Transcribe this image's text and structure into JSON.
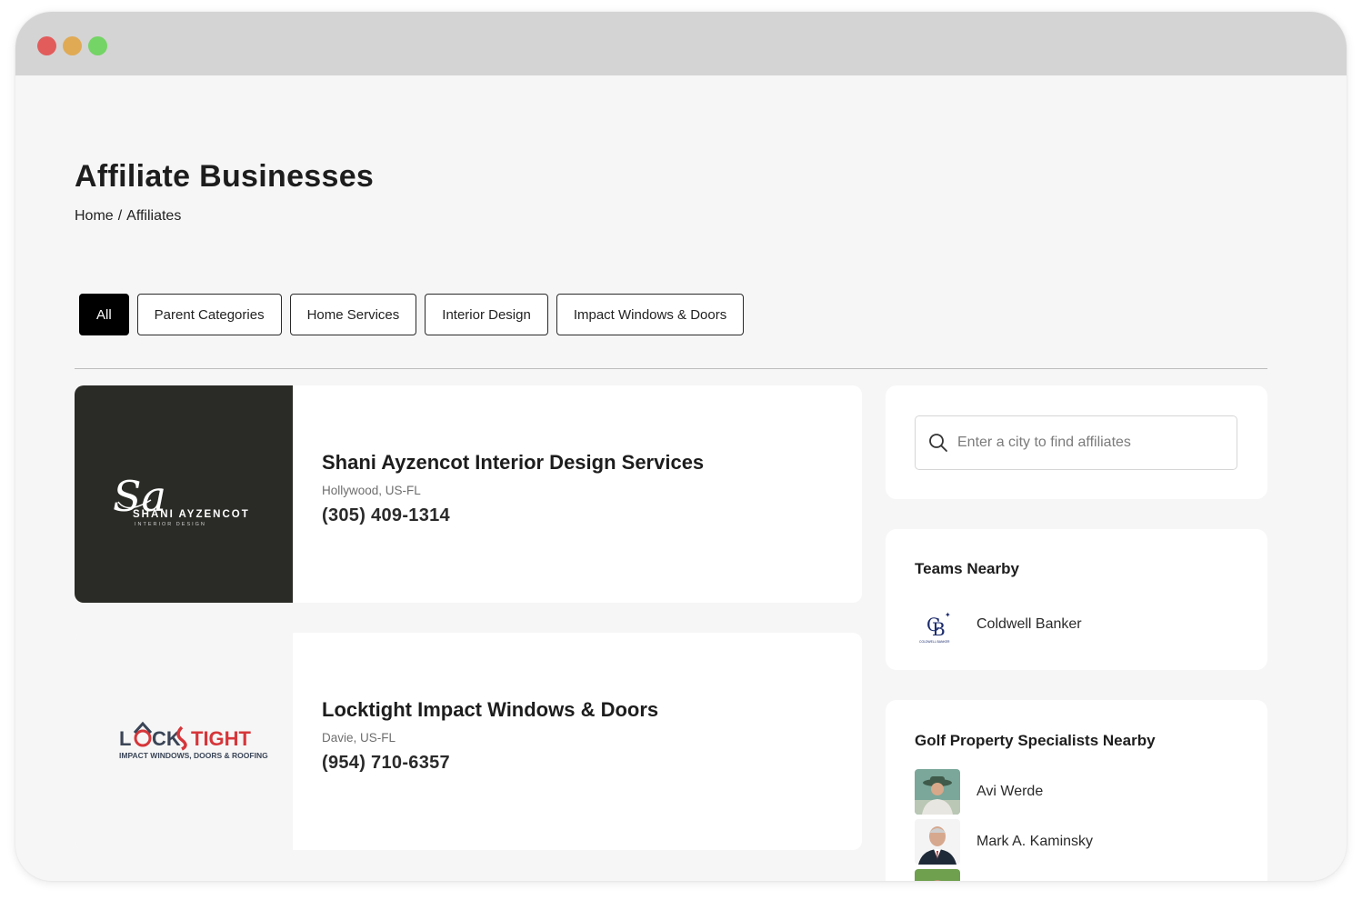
{
  "window": {
    "controls": [
      "close",
      "minimize",
      "maximize"
    ]
  },
  "page": {
    "title": "Affiliate Businesses",
    "breadcrumb": {
      "home": "Home",
      "separator": "/",
      "current": "Affiliates"
    }
  },
  "filters": [
    {
      "label": "All",
      "active": true
    },
    {
      "label": "Parent Categories",
      "active": false
    },
    {
      "label": "Home Services",
      "active": false
    },
    {
      "label": "Interior Design",
      "active": false
    },
    {
      "label": "Impact Windows & Doors",
      "active": false
    }
  ],
  "businesses": [
    {
      "name": "Shani Ayzencot Interior Design Services",
      "location": "Hollywood, US-FL",
      "phone": "(305) 409-1314",
      "logo": {
        "monogram": "Sa",
        "line1": "SHANI AYZENCOT",
        "line2": "INTERIOR DESIGN"
      }
    },
    {
      "name": "Locktight Impact Windows & Doors",
      "location": "Davie, US-FL",
      "phone": "(954) 710-6357",
      "logo": {
        "part1": "L",
        "part2": "CK",
        "part3": "TIGHT",
        "tagline": "IMPACT WINDOWS, DOORS & ROOFING"
      }
    }
  ],
  "sidebar": {
    "search": {
      "placeholder": "Enter a city to find affiliates",
      "icon": "search-icon"
    },
    "teams": {
      "heading": "Teams Nearby",
      "items": [
        {
          "name": "Coldwell Banker",
          "logo_text": "COLDWELL BANKER"
        }
      ]
    },
    "golf": {
      "heading": "Golf Property Specialists Nearby",
      "items": [
        {
          "name": "Avi Werde"
        },
        {
          "name": "Mark A. Kaminsky"
        }
      ]
    }
  },
  "colors": {
    "accent_black": "#000000",
    "logo_dark_bg": "#2a2b26",
    "locktight_red": "#d6363a",
    "locktight_navy": "#3a4557",
    "coldwell_blue": "#1a2a6c"
  }
}
